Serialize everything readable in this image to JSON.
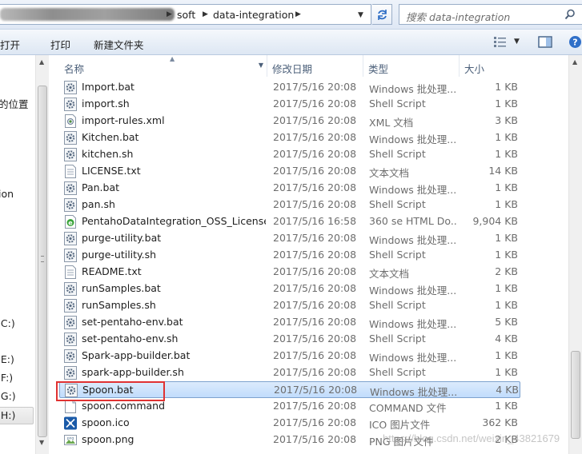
{
  "address": {
    "crumbs": [
      "soft",
      "data-integration"
    ],
    "search_placeholder": "搜索 data-integration"
  },
  "toolbar": {
    "open_label": "打开",
    "print_label": "打印",
    "new_folder_label": "新建文件夹"
  },
  "nav": {
    "items": [
      "的位置",
      "ion",
      "(C:)",
      "(E:)",
      "(F:)",
      "(G:)",
      "(H:)"
    ],
    "selected": "(H:)"
  },
  "columns": {
    "name": "名称",
    "date": "修改日期",
    "type": "类型",
    "size": "大小"
  },
  "files": [
    {
      "name": "Import.bat",
      "date": "2017/5/16 20:08",
      "type": "Windows 批处理...",
      "size": "1 KB",
      "icon": "bat-gear-icon"
    },
    {
      "name": "import.sh",
      "date": "2017/5/16 20:08",
      "type": "Shell Script",
      "size": "1 KB",
      "icon": "sh-gear-icon"
    },
    {
      "name": "import-rules.xml",
      "date": "2017/5/16 20:08",
      "type": "XML 文档",
      "size": "3 KB",
      "icon": "xml-file-icon"
    },
    {
      "name": "Kitchen.bat",
      "date": "2017/5/16 20:08",
      "type": "Windows 批处理...",
      "size": "1 KB",
      "icon": "bat-gear-icon"
    },
    {
      "name": "kitchen.sh",
      "date": "2017/5/16 20:08",
      "type": "Shell Script",
      "size": "1 KB",
      "icon": "sh-gear-icon"
    },
    {
      "name": "LICENSE.txt",
      "date": "2017/5/16 20:08",
      "type": "文本文档",
      "size": "14 KB",
      "icon": "text-file-icon"
    },
    {
      "name": "Pan.bat",
      "date": "2017/5/16 20:08",
      "type": "Windows 批处理...",
      "size": "1 KB",
      "icon": "bat-gear-icon"
    },
    {
      "name": "pan.sh",
      "date": "2017/5/16 20:08",
      "type": "Shell Script",
      "size": "1 KB",
      "icon": "sh-gear-icon"
    },
    {
      "name": "PentahoDataIntegration_OSS_License...",
      "date": "2017/5/16 16:58",
      "type": "360 se HTML Do...",
      "size": "9,904 KB",
      "icon": "html-file-icon"
    },
    {
      "name": "purge-utility.bat",
      "date": "2017/5/16 20:08",
      "type": "Windows 批处理...",
      "size": "1 KB",
      "icon": "bat-gear-icon"
    },
    {
      "name": "purge-utility.sh",
      "date": "2017/5/16 20:08",
      "type": "Shell Script",
      "size": "1 KB",
      "icon": "sh-gear-icon"
    },
    {
      "name": "README.txt",
      "date": "2017/5/16 20:08",
      "type": "文本文档",
      "size": "2 KB",
      "icon": "text-file-icon"
    },
    {
      "name": "runSamples.bat",
      "date": "2017/5/16 20:08",
      "type": "Windows 批处理...",
      "size": "1 KB",
      "icon": "bat-gear-icon"
    },
    {
      "name": "runSamples.sh",
      "date": "2017/5/16 20:08",
      "type": "Shell Script",
      "size": "1 KB",
      "icon": "sh-gear-icon"
    },
    {
      "name": "set-pentaho-env.bat",
      "date": "2017/5/16 20:08",
      "type": "Windows 批处理...",
      "size": "5 KB",
      "icon": "bat-gear-icon"
    },
    {
      "name": "set-pentaho-env.sh",
      "date": "2017/5/16 20:08",
      "type": "Shell Script",
      "size": "4 KB",
      "icon": "sh-gear-icon"
    },
    {
      "name": "Spark-app-builder.bat",
      "date": "2017/5/16 20:08",
      "type": "Windows 批处理...",
      "size": "1 KB",
      "icon": "bat-gear-icon"
    },
    {
      "name": "spark-app-builder.sh",
      "date": "2017/5/16 20:08",
      "type": "Shell Script",
      "size": "1 KB",
      "icon": "sh-gear-icon"
    },
    {
      "name": "Spoon.bat",
      "date": "2017/5/16 20:08",
      "type": "Windows 批处理...",
      "size": "4 KB",
      "icon": "bat-gear-icon",
      "selected": true
    },
    {
      "name": "spoon.command",
      "date": "2017/5/16 20:08",
      "type": "COMMAND 文件",
      "size": "1 KB",
      "icon": "blank-file-icon"
    },
    {
      "name": "spoon.ico",
      "date": "2017/5/16 20:08",
      "type": "ICO 图片文件",
      "size": "362 KB",
      "icon": "spoon-ico-icon"
    },
    {
      "name": "spoon.png",
      "date": "2017/5/16 20:08",
      "type": "PNG 图片文件",
      "size": "2 KB",
      "icon": "png-file-icon"
    }
  ],
  "watermark": "https://blog.csdn.net/weixin_43821679",
  "colors": {
    "selected_row": "#c1dcfc",
    "highlight_border": "#e03232",
    "header_text": "#4c607a"
  }
}
